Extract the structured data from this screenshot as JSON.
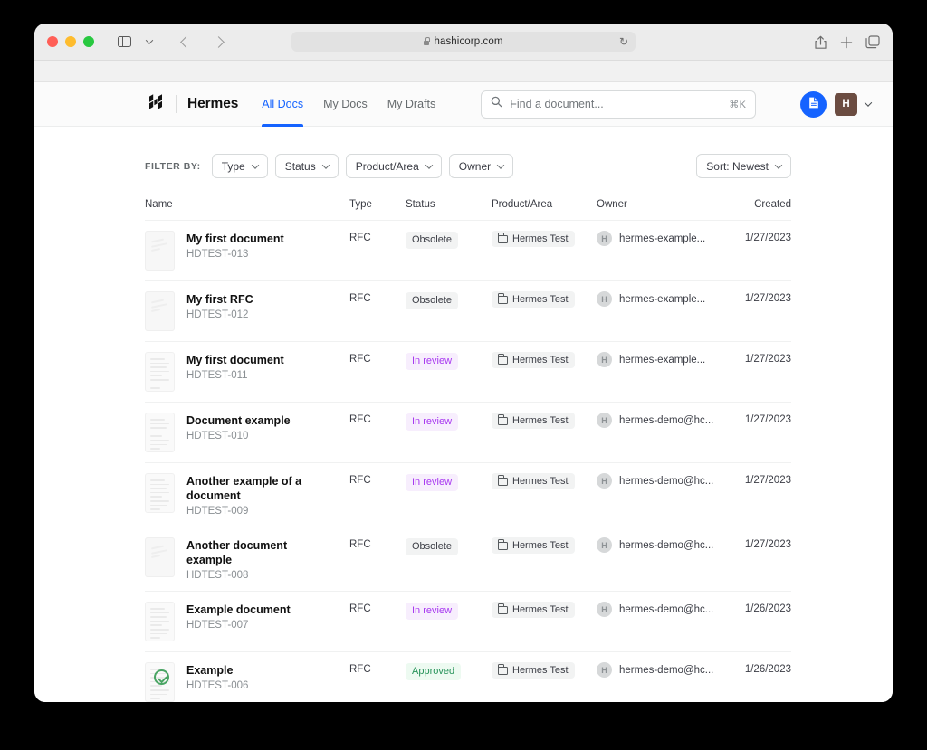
{
  "browser": {
    "url": "hashicorp.com",
    "lock_icon": "lock-icon",
    "reload_icon": "reload-icon",
    "sidebar_icon": "sidebar-toggle-icon",
    "back_icon": "back-arrow-icon",
    "forward_icon": "forward-arrow-icon",
    "share_icon": "share-icon",
    "new_tab_icon": "plus-icon",
    "tabs_icon": "tab-overview-icon"
  },
  "header": {
    "brand": "Hermes",
    "logo_icon": "hashicorp-logo-icon",
    "tabs": [
      {
        "label": "All Docs",
        "active": true
      },
      {
        "label": "My Docs",
        "active": false
      },
      {
        "label": "My Drafts",
        "active": false
      }
    ],
    "search": {
      "placeholder": "Find a document...",
      "shortcut": "⌘K",
      "icon": "search-icon"
    },
    "new_doc_icon": "new-document-icon",
    "avatar_initial": "H",
    "accent_color": "#1563ff"
  },
  "filters": {
    "label": "FILTER BY:",
    "options": [
      {
        "label": "Type"
      },
      {
        "label": "Status"
      },
      {
        "label": "Product/Area"
      },
      {
        "label": "Owner"
      }
    ],
    "sort": {
      "label": "Sort: Newest"
    }
  },
  "table": {
    "columns": [
      "Name",
      "Type",
      "Status",
      "Product/Area",
      "Owner",
      "Created"
    ],
    "rows": [
      {
        "title": "My first document",
        "id": "HDTEST-013",
        "type": "RFC",
        "status": "Obsolete",
        "status_kind": "obsolete",
        "product": "Hermes Test",
        "owner": "hermes-example...",
        "owner_initial": "H",
        "created": "1/27/2023",
        "thumb": "obsolete"
      },
      {
        "title": "My first RFC",
        "id": "HDTEST-012",
        "type": "RFC",
        "status": "Obsolete",
        "status_kind": "obsolete",
        "product": "Hermes Test",
        "owner": "hermes-example...",
        "owner_initial": "H",
        "created": "1/27/2023",
        "thumb": "obsolete"
      },
      {
        "title": "My first document",
        "id": "HDTEST-011",
        "type": "RFC",
        "status": "In review",
        "status_kind": "inreview",
        "product": "Hermes Test",
        "owner": "hermes-example...",
        "owner_initial": "H",
        "created": "1/27/2023",
        "thumb": "text"
      },
      {
        "title": "Document example",
        "id": "HDTEST-010",
        "type": "RFC",
        "status": "In review",
        "status_kind": "inreview",
        "product": "Hermes Test",
        "owner": "hermes-demo@hc...",
        "owner_initial": "H",
        "created": "1/27/2023",
        "thumb": "text"
      },
      {
        "title": "Another example of a document",
        "id": "HDTEST-009",
        "type": "RFC",
        "status": "In review",
        "status_kind": "inreview",
        "product": "Hermes Test",
        "owner": "hermes-demo@hc...",
        "owner_initial": "H",
        "created": "1/27/2023",
        "thumb": "text"
      },
      {
        "title": "Another document example",
        "id": "HDTEST-008",
        "type": "RFC",
        "status": "Obsolete",
        "status_kind": "obsolete",
        "product": "Hermes Test",
        "owner": "hermes-demo@hc...",
        "owner_initial": "H",
        "created": "1/27/2023",
        "thumb": "obsolete"
      },
      {
        "title": "Example document",
        "id": "HDTEST-007",
        "type": "RFC",
        "status": "In review",
        "status_kind": "inreview",
        "product": "Hermes Test",
        "owner": "hermes-demo@hc...",
        "owner_initial": "H",
        "created": "1/26/2023",
        "thumb": "text"
      },
      {
        "title": "Example",
        "id": "HDTEST-006",
        "type": "RFC",
        "status": "Approved",
        "status_kind": "approved",
        "product": "Hermes Test",
        "owner": "hermes-demo@hc...",
        "owner_initial": "H",
        "created": "1/26/2023",
        "thumb": "approved"
      }
    ]
  },
  "colors": {
    "accent": "#1563ff",
    "approved": "#27935a",
    "in_review": "#a737f0",
    "obsolete": "#3b3d45"
  }
}
